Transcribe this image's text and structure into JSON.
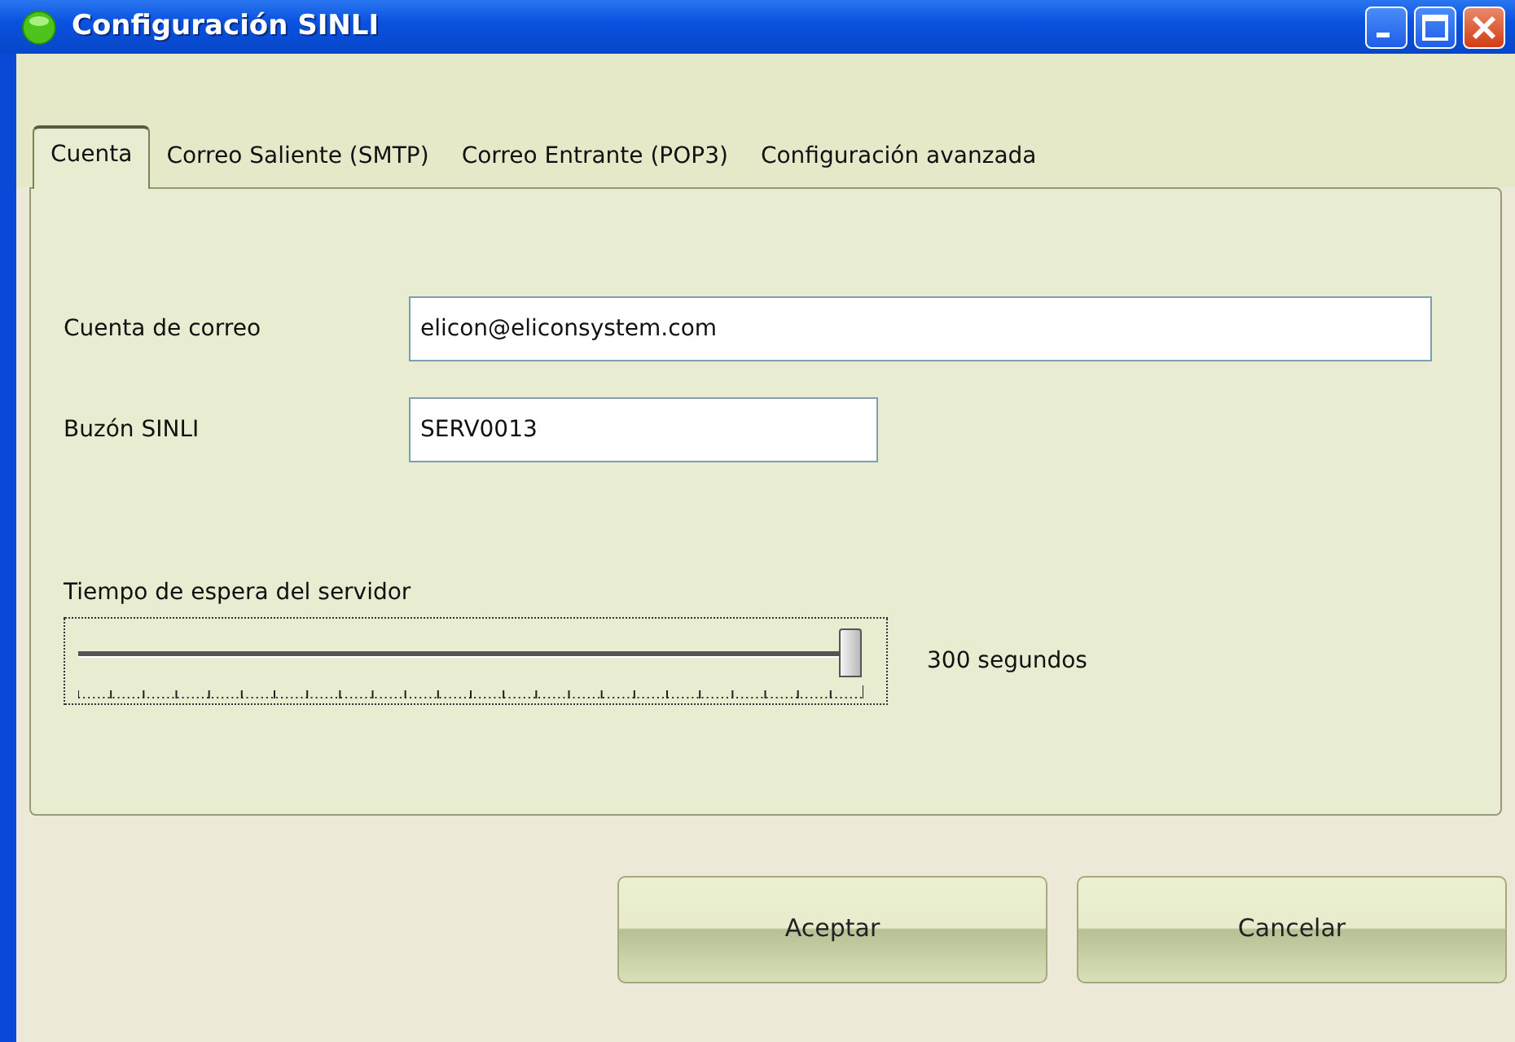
{
  "window": {
    "title": "Configuración SINLI"
  },
  "tabs": [
    {
      "label": "Cuenta",
      "selected": true
    },
    {
      "label": "Correo Saliente (SMTP)",
      "selected": false
    },
    {
      "label": "Correo Entrante (POP3)",
      "selected": false
    },
    {
      "label": "Configuración avanzada",
      "selected": false
    }
  ],
  "fields": [
    {
      "label": "Cuenta de correo",
      "value": "elicon@eliconsystem.com",
      "kind": "wide"
    },
    {
      "label": "Buzón SINLI",
      "value": "SERV0013",
      "kind": "short"
    }
  ],
  "timeout": {
    "label": "Tiempo de espera del servidor",
    "level": 1,
    "reading": "300 segundos"
  },
  "buttons": [
    "Aceptar",
    "Cancelar"
  ]
}
